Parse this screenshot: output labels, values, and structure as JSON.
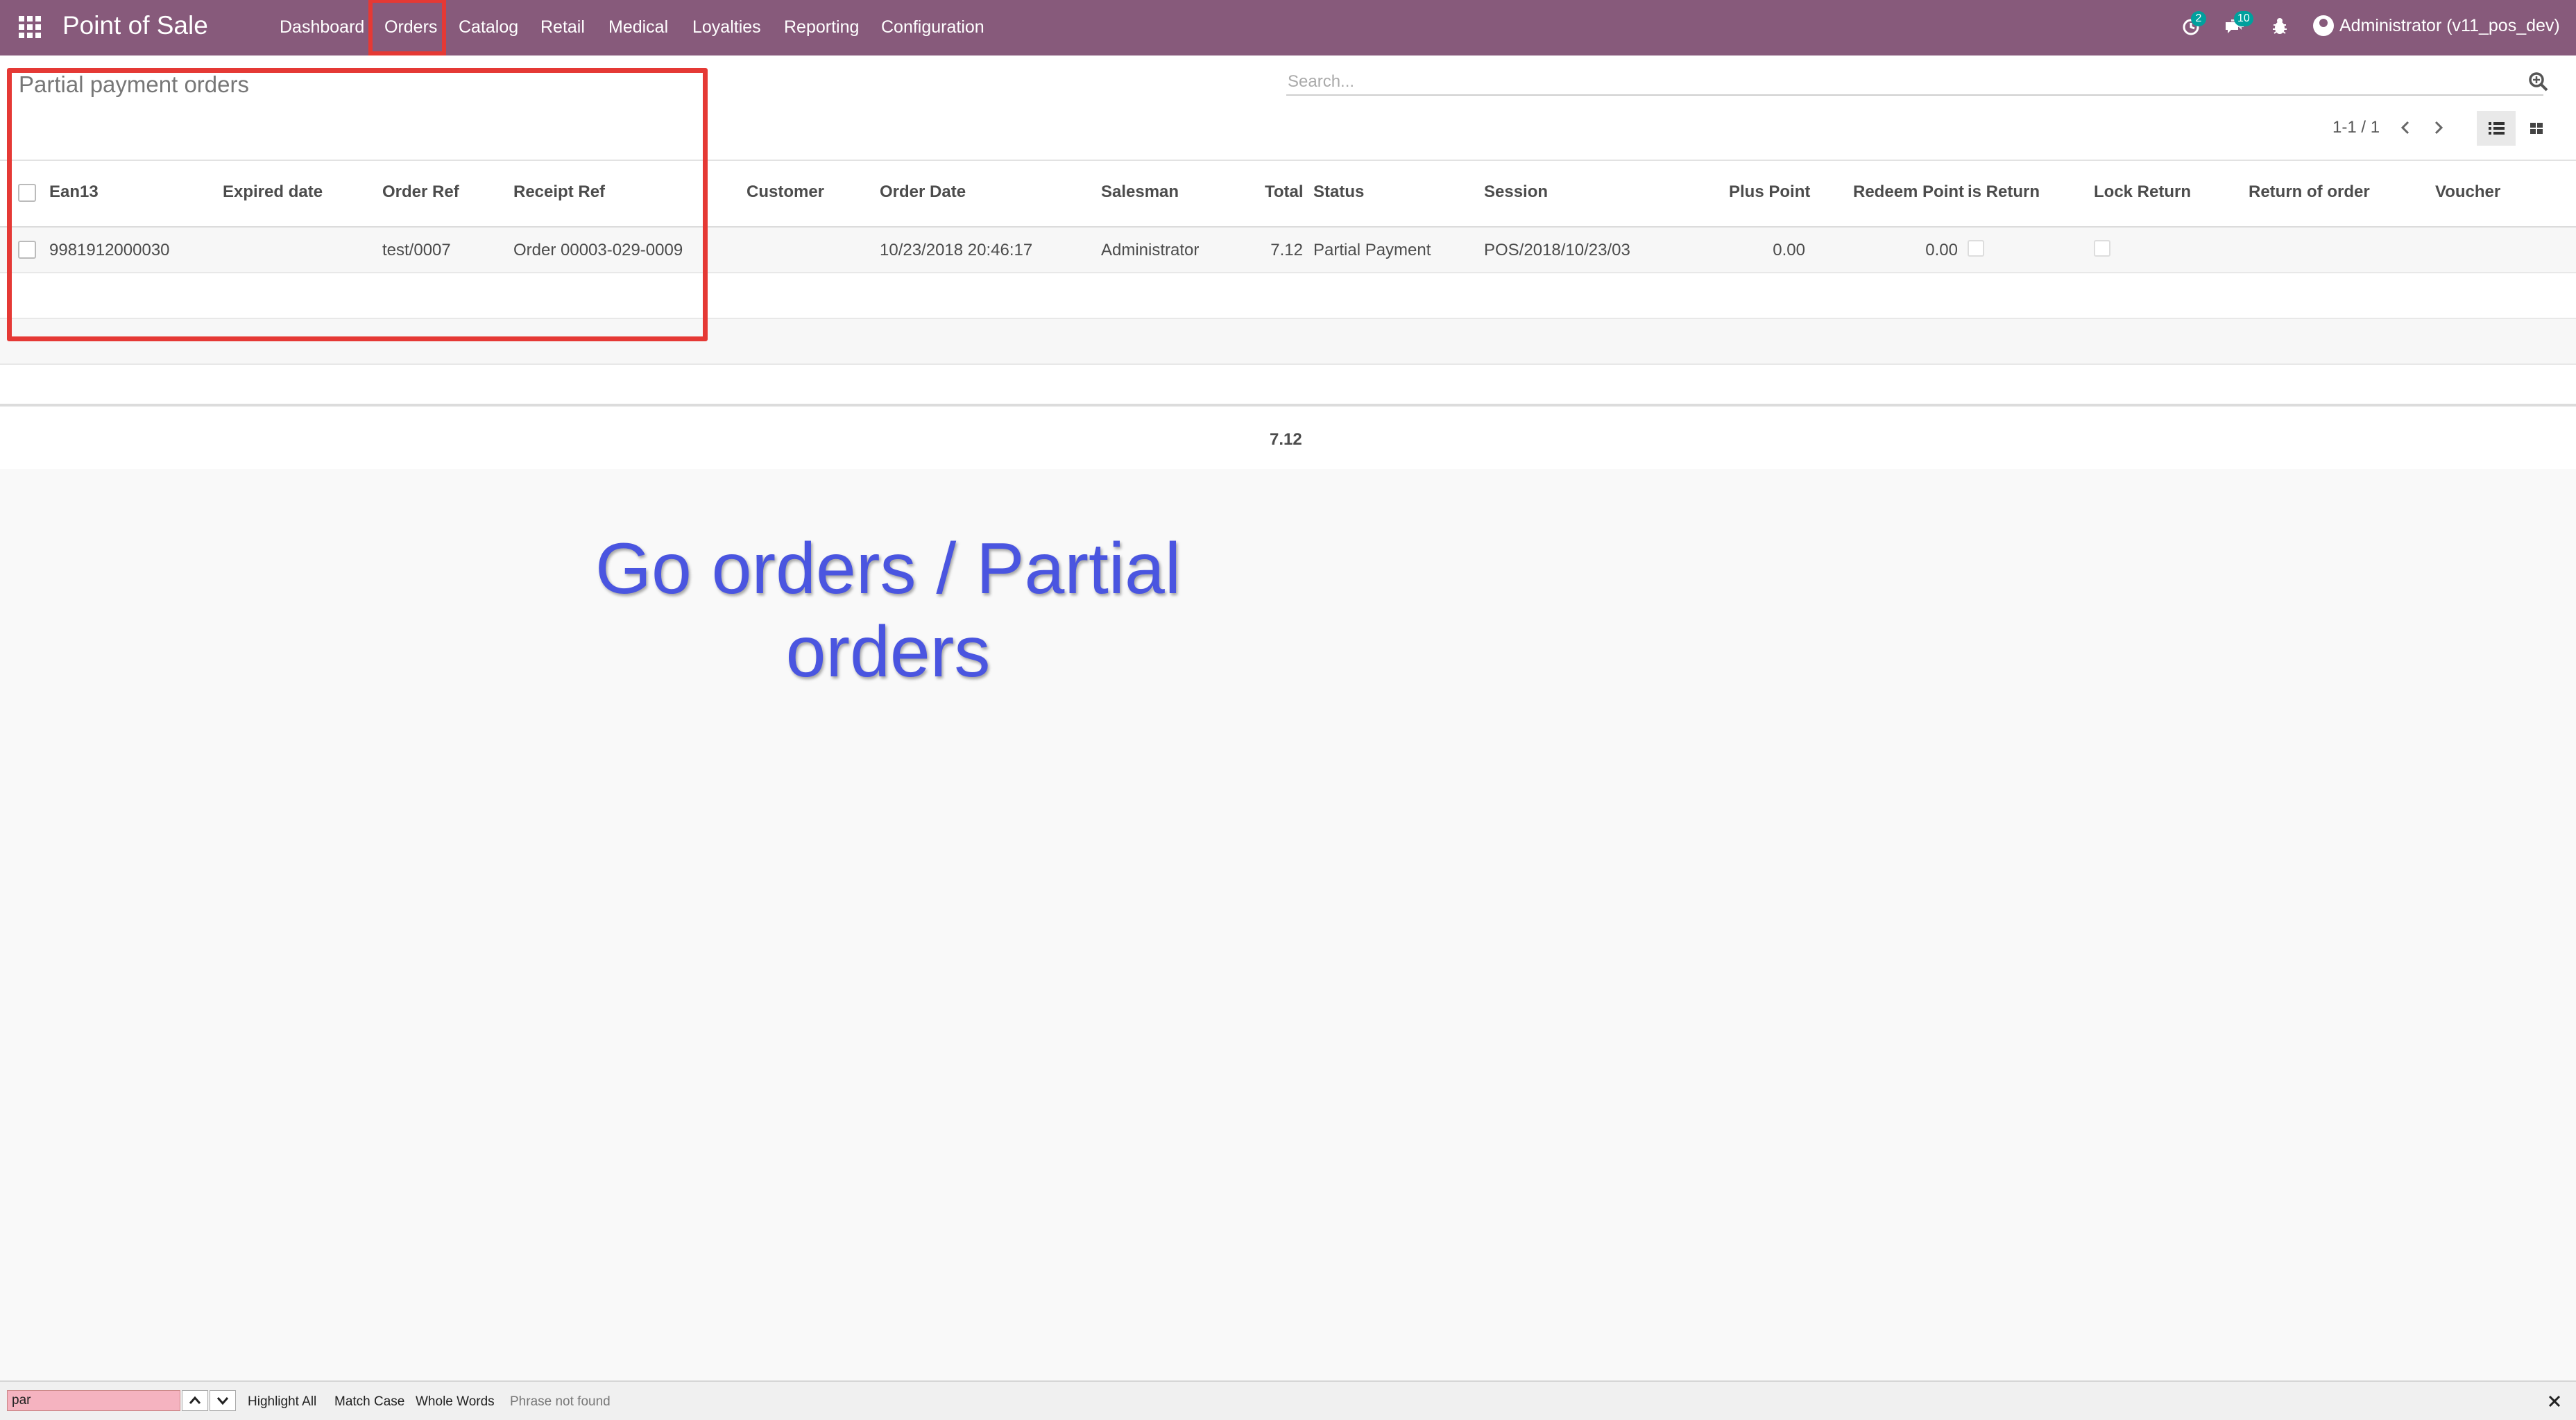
{
  "navbar": {
    "app_title": "Point of Sale",
    "menu": [
      "Dashboard",
      "Orders",
      "Catalog",
      "Retail",
      "Medical",
      "Loyalties",
      "Reporting",
      "Configuration"
    ],
    "activity_badge": "2",
    "messages_badge": "10",
    "user_label": "Administrator (v11_pos_dev)",
    "icons": [
      "apps-grid-icon",
      "activity-clock-icon",
      "chat-icon",
      "bug-icon",
      "user-avatar-icon"
    ]
  },
  "control_panel": {
    "breadcrumb": "Partial payment orders",
    "search_placeholder": "Search...",
    "pager": "1-1 / 1",
    "views": [
      "list-view-icon",
      "kanban-view-icon"
    ]
  },
  "table": {
    "columns": [
      "Ean13",
      "Expired date",
      "Order Ref",
      "Receipt Ref",
      "Customer",
      "Order Date",
      "Salesman",
      "Total",
      "Status",
      "Session",
      "Plus Point",
      "Redeem Point",
      "is Return",
      "Lock Return",
      "Return of order",
      "Voucher"
    ],
    "rows": [
      {
        "ean13": "9981912000030",
        "expired_date": "",
        "order_ref": "test/0007",
        "receipt_ref": "Order 00003-029-0009",
        "customer": "",
        "order_date": "10/23/2018 20:46:17",
        "salesman": "Administrator",
        "total": "7.12",
        "status": "Partial Payment",
        "session": "POS/2018/10/23/03",
        "plus_point": "0.00",
        "redeem_point": "0.00",
        "is_return": false,
        "lock_return": false,
        "return_of_order": "",
        "voucher": ""
      }
    ],
    "footer_total": "7.12"
  },
  "annotation": {
    "line1": "Go orders / Partial",
    "line2": "orders",
    "color": "#4a55e0"
  },
  "findbar": {
    "query": "par",
    "highlight_all": "Highlight All",
    "match_case": "Match Case",
    "whole_words": "Whole Words",
    "status": "Phrase not found"
  },
  "colors": {
    "navbar": "#875a7b",
    "badge": "#00a09d",
    "annotation_border": "#e53935"
  }
}
